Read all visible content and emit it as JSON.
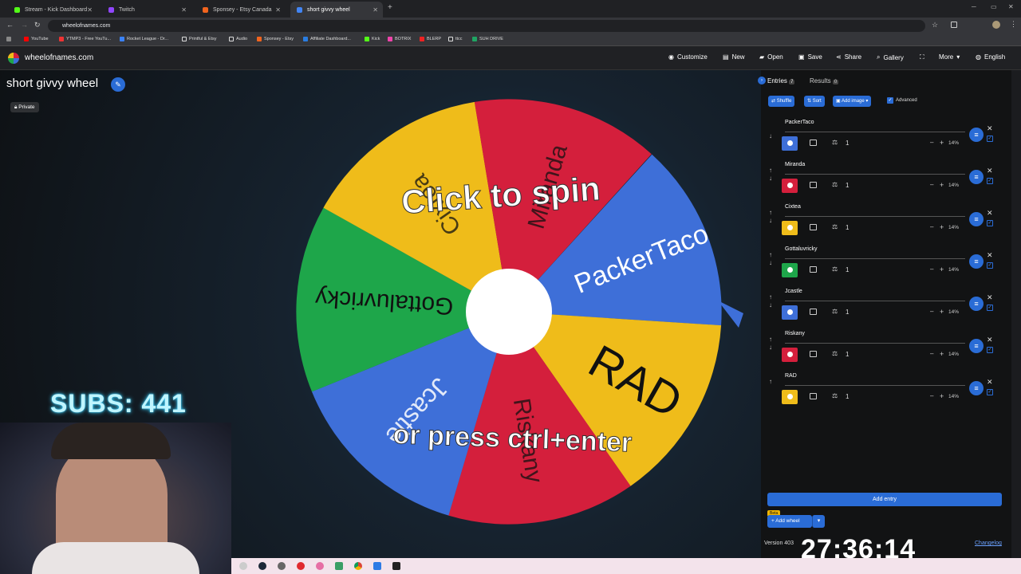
{
  "browser": {
    "tabs": [
      {
        "label": "Stream - Kick Dashboard",
        "color": "#53fc18"
      },
      {
        "label": "Twitch",
        "color": "#9146ff"
      },
      {
        "label": "Sponsey - Etsy Canada",
        "color": "#f1641e"
      },
      {
        "label": "short givvy wheel",
        "color": "#4285f4"
      }
    ],
    "url": "wheelofnames.com",
    "bookmarks": [
      "YouTube",
      "YTMP3 - Free YouTu...",
      "Rocket League - Dr...",
      "Printful & Etsy",
      "Audio",
      "Sponsey - Etsy",
      "Affiliate Dashboard...",
      "Kick",
      "BOTRIX",
      "BLERP",
      "ttcc",
      "SUH DRIVE"
    ]
  },
  "header": {
    "brand": "wheelofnames.com",
    "nav": [
      "Customize",
      "New",
      "Open",
      "Save",
      "Share",
      "Gallery",
      "More",
      "English"
    ]
  },
  "page": {
    "title": "short givvy wheel",
    "private_label": "Private"
  },
  "wheel": {
    "click_text": "Click to spin",
    "press_text": "or press ctrl+enter",
    "segments": [
      {
        "label": "PackerTaco",
        "color": "#3e6fd8"
      },
      {
        "label": "RAD",
        "color": "#efbc1a"
      },
      {
        "label": "Riskany",
        "color": "#d41f3c"
      },
      {
        "label": "Jcastle",
        "color": "#3e6fd8"
      },
      {
        "label": "Gottaluvricky",
        "color": "#1ea64a"
      },
      {
        "label": "Cixtea",
        "color": "#efbc1a"
      },
      {
        "label": "Miranda",
        "color": "#d41f3c"
      }
    ]
  },
  "panel": {
    "tab_entries": "Entries",
    "entries_count": "7",
    "tab_results": "Results",
    "results_count": "0",
    "shuffle": "Shuffle",
    "sort": "Sort",
    "add_image": "Add image",
    "advanced": "Advanced",
    "entries": [
      {
        "name": "PackerTaco",
        "weight": "1",
        "pct": "14%",
        "color": "#3e6fd8"
      },
      {
        "name": "Miranda",
        "weight": "1",
        "pct": "14%",
        "color": "#d41f3c"
      },
      {
        "name": "Cixtea",
        "weight": "1",
        "pct": "14%",
        "color": "#efbc1a"
      },
      {
        "name": "Gottaluvricky",
        "weight": "1",
        "pct": "14%",
        "color": "#1ea64a"
      },
      {
        "name": "Jcastle",
        "weight": "1",
        "pct": "14%",
        "color": "#3e6fd8"
      },
      {
        "name": "Riskany",
        "weight": "1",
        "pct": "14%",
        "color": "#d41f3c"
      },
      {
        "name": "RAD",
        "weight": "1",
        "pct": "14%",
        "color": "#efbc1a"
      }
    ],
    "add_entry": "Add entry",
    "beta": "Beta",
    "add_wheel": "Add wheel",
    "version": "Version 403",
    "changelog": "Changelog"
  },
  "overlay": {
    "subs": "SUBS: 441",
    "timer": "27:36:14"
  }
}
